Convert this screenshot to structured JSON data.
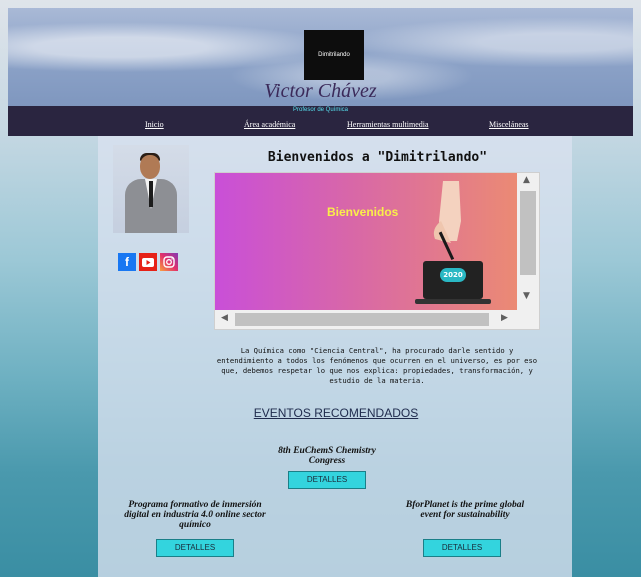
{
  "header": {
    "logo_text": "Dimitrilando",
    "brand": "Victor Chávez",
    "subtitle": "Profesor de Química"
  },
  "nav": {
    "items": [
      "Inicio",
      "Área académica",
      "Herramientas multimedia",
      "Misceláneas"
    ]
  },
  "main": {
    "welcome": "Bienvenidos a \"Dimitrilando\"",
    "video": {
      "title": "Bienvenidos",
      "year": "2020"
    },
    "intro": "La Química como \"Ciencia Central\", ha procurado darle sentido y entendimiento a todos los fenómenos que ocurren en el universo, es por eso que, debemos respetar lo que nos explica: propiedades, transformación, y estudio de la materia."
  },
  "socials": [
    "facebook-icon",
    "youtube-icon",
    "instagram-icon"
  ],
  "events": {
    "title": "EVENTOS RECOMENDADOS",
    "items": [
      {
        "name": "8th EuChemS Chemistry Congress",
        "button": "DETALLES"
      },
      {
        "name": "Programa formativo de inmersión digital en industria 4.0 online sector químico",
        "button": "DETALLES"
      },
      {
        "name": "BforPlanet is the prime global event for sustainability",
        "button": "DETALLES"
      }
    ]
  },
  "colors": {
    "nav_bg": "#2a2540",
    "subtitle": "#57e1f0",
    "button_bg": "#33d4de",
    "events_title": "#1f2b4d"
  }
}
